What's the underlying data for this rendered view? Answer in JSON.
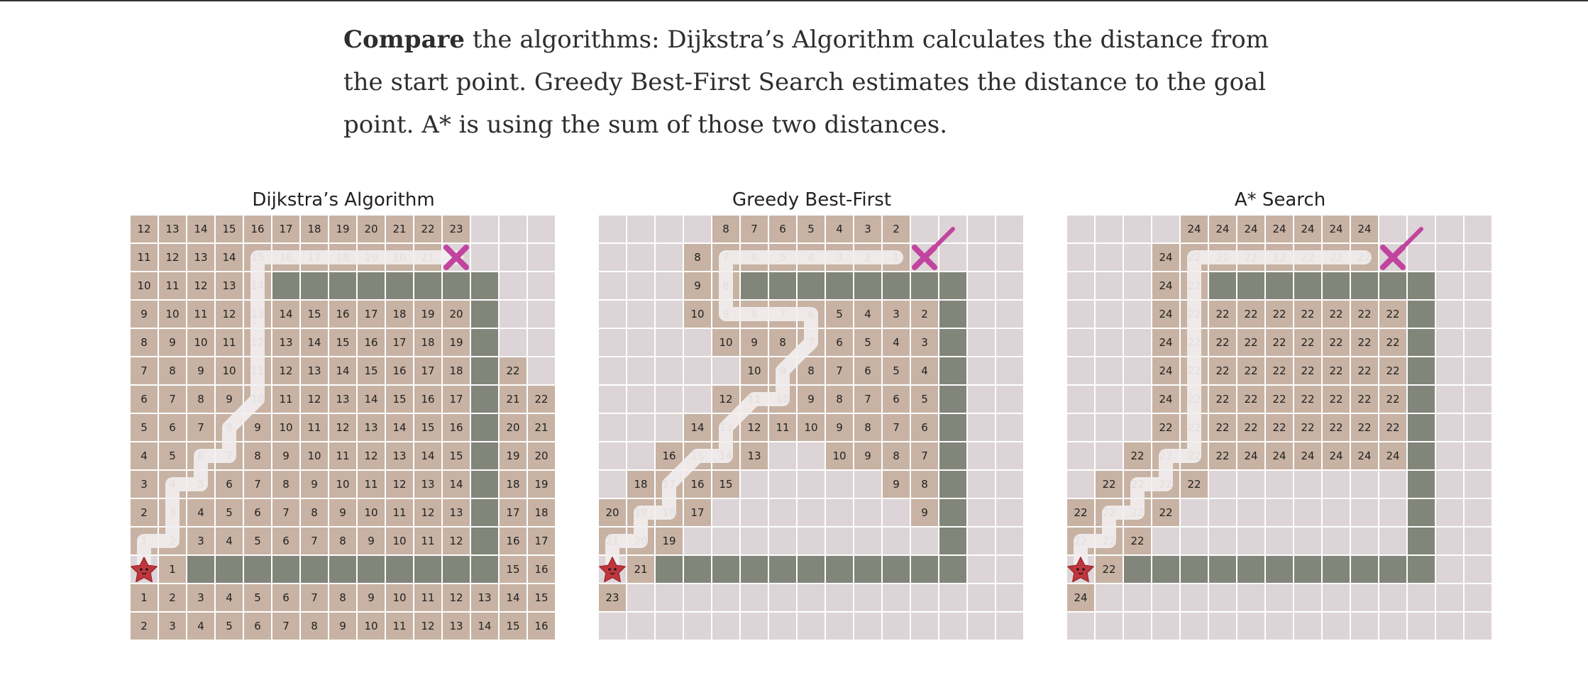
{
  "intro": {
    "bold": "Compare",
    "text": " the algorithms: Dijkstra’s Algorithm calculates the distance from the start point. Greedy Best-First Search estimates the distance to the goal point. A* is using the sum of those two distances."
  },
  "colors": {
    "empty": "#dcd4d6",
    "visited": "#c7b2a3",
    "wall": "#82857a",
    "path": "#f2efef",
    "start": "#c0363d",
    "goal": "#c2449e"
  },
  "icons": {
    "start": "star-icon",
    "goal": "x-mark-icon"
  },
  "panels": [
    {
      "title": "Dijkstra’s Algorithm",
      "grid": [
        [
          "12",
          "13",
          "14",
          "15",
          "16",
          "17",
          "18",
          "19",
          "20",
          "21",
          "22",
          "23",
          "",
          "",
          ""
        ],
        [
          "11",
          "12",
          "13",
          "14",
          "15",
          "16",
          "17",
          "18",
          "19",
          "20",
          "21",
          "G",
          "",
          "",
          ""
        ],
        [
          "10",
          "11",
          "12",
          "13",
          "14",
          "#",
          "#",
          "#",
          "#",
          "#",
          "#",
          "#",
          "#",
          "",
          ""
        ],
        [
          "9",
          "10",
          "11",
          "12",
          "13",
          "14",
          "15",
          "16",
          "17",
          "18",
          "19",
          "20",
          "#",
          "",
          ""
        ],
        [
          "8",
          "9",
          "10",
          "11",
          "12",
          "13",
          "14",
          "15",
          "16",
          "17",
          "18",
          "19",
          "#",
          "",
          ""
        ],
        [
          "7",
          "8",
          "9",
          "10",
          "11",
          "12",
          "13",
          "14",
          "15",
          "16",
          "17",
          "18",
          "#",
          "22",
          ""
        ],
        [
          "6",
          "7",
          "8",
          "9",
          "10",
          "11",
          "12",
          "13",
          "14",
          "15",
          "16",
          "17",
          "#",
          "21",
          "22"
        ],
        [
          "5",
          "6",
          "7",
          "8",
          "9",
          "10",
          "11",
          "12",
          "13",
          "14",
          "15",
          "16",
          "#",
          "20",
          "21"
        ],
        [
          "4",
          "5",
          "6",
          "7",
          "8",
          "9",
          "10",
          "11",
          "12",
          "13",
          "14",
          "15",
          "#",
          "19",
          "20"
        ],
        [
          "3",
          "4",
          "5",
          "6",
          "7",
          "8",
          "9",
          "10",
          "11",
          "12",
          "13",
          "14",
          "#",
          "18",
          "19"
        ],
        [
          "2",
          "3",
          "4",
          "5",
          "6",
          "7",
          "8",
          "9",
          "10",
          "11",
          "12",
          "13",
          "#",
          "17",
          "18"
        ],
        [
          "1",
          "2",
          "3",
          "4",
          "5",
          "6",
          "7",
          "8",
          "9",
          "10",
          "11",
          "12",
          "#",
          "16",
          "17"
        ],
        [
          "S",
          "1",
          "#",
          "#",
          "#",
          "#",
          "#",
          "#",
          "#",
          "#",
          "#",
          "#",
          "#",
          "15",
          "16"
        ],
        [
          "1",
          "2",
          "3",
          "4",
          "5",
          "6",
          "7",
          "8",
          "9",
          "10",
          "11",
          "12",
          "13",
          "14",
          "15"
        ],
        [
          "2",
          "3",
          "4",
          "5",
          "6",
          "7",
          "8",
          "9",
          "10",
          "11",
          "12",
          "13",
          "14",
          "15",
          "16"
        ]
      ],
      "path": [
        [
          12,
          0
        ],
        [
          11,
          0
        ],
        [
          11,
          1
        ],
        [
          10,
          1
        ],
        [
          9,
          1
        ],
        [
          9,
          2
        ],
        [
          8,
          2
        ],
        [
          8,
          3
        ],
        [
          7,
          3
        ],
        [
          6,
          4
        ],
        [
          5,
          4
        ],
        [
          4,
          4
        ],
        [
          3,
          4
        ],
        [
          2,
          4
        ],
        [
          1,
          4
        ],
        [
          1,
          5
        ],
        [
          1,
          6
        ],
        [
          1,
          7
        ],
        [
          1,
          8
        ],
        [
          1,
          9
        ],
        [
          1,
          10
        ],
        [
          1,
          11
        ]
      ],
      "arrow": false
    },
    {
      "title": "Greedy Best-First",
      "grid": [
        [
          "",
          "",
          "",
          "",
          "8",
          "7",
          "6",
          "5",
          "4",
          "3",
          "2",
          "",
          "",
          "",
          ""
        ],
        [
          "",
          "",
          "",
          "8",
          "7",
          "6",
          "5",
          "4",
          "3",
          "2",
          "1",
          "G",
          "",
          "",
          ""
        ],
        [
          "",
          "",
          "",
          "9",
          "8",
          "#",
          "#",
          "#",
          "#",
          "#",
          "#",
          "#",
          "#",
          "",
          ""
        ],
        [
          "",
          "",
          "",
          "10",
          "9",
          "8",
          "7",
          "6",
          "5",
          "4",
          "3",
          "2",
          "#",
          "",
          ""
        ],
        [
          "",
          "",
          "",
          "",
          "10",
          "9",
          "8",
          "7",
          "6",
          "5",
          "4",
          "3",
          "#",
          "",
          ""
        ],
        [
          "",
          "",
          "",
          "",
          "",
          "10",
          "9",
          "8",
          "7",
          "6",
          "5",
          "4",
          "#",
          "",
          ""
        ],
        [
          "",
          "",
          "",
          "",
          "12",
          "11",
          "10",
          "9",
          "8",
          "7",
          "6",
          "5",
          "#",
          "",
          ""
        ],
        [
          "",
          "",
          "",
          "14",
          "13",
          "12",
          "11",
          "10",
          "9",
          "8",
          "7",
          "6",
          "#",
          "",
          ""
        ],
        [
          "",
          "",
          "16",
          "15",
          "14",
          "13",
          "",
          "",
          "10",
          "9",
          "8",
          "7",
          "#",
          "",
          ""
        ],
        [
          "",
          "18",
          "17",
          "16",
          "15",
          "",
          "",
          "",
          "",
          "",
          "9",
          "8",
          "#",
          "",
          ""
        ],
        [
          "20",
          "19",
          "18",
          "17",
          "",
          "",
          "",
          "",
          "",
          "",
          "",
          "9",
          "#",
          "",
          ""
        ],
        [
          "21",
          "20",
          "19",
          "",
          "",
          "",
          "",
          "",
          "",
          "",
          "",
          "",
          "#",
          "",
          ""
        ],
        [
          "S",
          "21",
          "#",
          "#",
          "#",
          "#",
          "#",
          "#",
          "#",
          "#",
          "#",
          "#",
          "#",
          "",
          ""
        ],
        [
          "23",
          "",
          "",
          "",
          "",
          "",
          "",
          "",
          "",
          "",
          "",
          "",
          "",
          "",
          ""
        ],
        [
          "",
          "",
          "",
          "",
          "",
          "",
          "",
          "",
          "",
          "",
          "",
          "",
          "",
          "",
          ""
        ]
      ],
      "path": [
        [
          12,
          0
        ],
        [
          11,
          0
        ],
        [
          11,
          1
        ],
        [
          10,
          1
        ],
        [
          10,
          2
        ],
        [
          9,
          2
        ],
        [
          8,
          3
        ],
        [
          8,
          4
        ],
        [
          7,
          4
        ],
        [
          6,
          5
        ],
        [
          6,
          6
        ],
        [
          5,
          6
        ],
        [
          4,
          7
        ],
        [
          3,
          7
        ],
        [
          3,
          6
        ],
        [
          3,
          5
        ],
        [
          3,
          4
        ],
        [
          2,
          4
        ],
        [
          1,
          4
        ],
        [
          1,
          5
        ],
        [
          1,
          6
        ],
        [
          1,
          7
        ],
        [
          1,
          8
        ],
        [
          1,
          9
        ],
        [
          1,
          10
        ]
      ],
      "arrow": true
    },
    {
      "title": "A* Search",
      "grid": [
        [
          "",
          "",
          "",
          "",
          "24",
          "24",
          "24",
          "24",
          "24",
          "24",
          "24",
          "",
          "",
          "",
          ""
        ],
        [
          "",
          "",
          "",
          "24",
          "22",
          "22",
          "22",
          "22",
          "22",
          "22",
          "22",
          "G",
          "",
          "",
          ""
        ],
        [
          "",
          "",
          "",
          "24",
          "22",
          "#",
          "#",
          "#",
          "#",
          "#",
          "#",
          "#",
          "#",
          "",
          ""
        ],
        [
          "",
          "",
          "",
          "24",
          "22",
          "22",
          "22",
          "22",
          "22",
          "22",
          "22",
          "22",
          "#",
          "",
          ""
        ],
        [
          "",
          "",
          "",
          "24",
          "22",
          "22",
          "22",
          "22",
          "22",
          "22",
          "22",
          "22",
          "#",
          "",
          ""
        ],
        [
          "",
          "",
          "",
          "24",
          "22",
          "22",
          "22",
          "22",
          "22",
          "22",
          "22",
          "22",
          "#",
          "",
          ""
        ],
        [
          "",
          "",
          "",
          "24",
          "22",
          "22",
          "22",
          "22",
          "22",
          "22",
          "22",
          "22",
          "#",
          "",
          ""
        ],
        [
          "",
          "",
          "",
          "22",
          "22",
          "22",
          "22",
          "22",
          "22",
          "22",
          "22",
          "22",
          "#",
          "",
          ""
        ],
        [
          "",
          "",
          "22",
          "22",
          "22",
          "22",
          "24",
          "24",
          "24",
          "24",
          "24",
          "24",
          "#",
          "",
          ""
        ],
        [
          "",
          "22",
          "22",
          "22",
          "22",
          "",
          "",
          "",
          "",
          "",
          "",
          "",
          "#",
          "",
          ""
        ],
        [
          "22",
          "22",
          "22",
          "22",
          "",
          "",
          "",
          "",
          "",
          "",
          "",
          "",
          "#",
          "",
          ""
        ],
        [
          "22",
          "22",
          "22",
          "",
          "",
          "",
          "",
          "",
          "",
          "",
          "",
          "",
          "#",
          "",
          ""
        ],
        [
          "S",
          "22",
          "#",
          "#",
          "#",
          "#",
          "#",
          "#",
          "#",
          "#",
          "#",
          "#",
          "#",
          "",
          ""
        ],
        [
          "24",
          "",
          "",
          "",
          "",
          "",
          "",
          "",
          "",
          "",
          "",
          "",
          "",
          "",
          ""
        ],
        [
          "",
          "",
          "",
          "",
          "",
          "",
          "",
          "",
          "",
          "",
          "",
          "",
          "",
          "",
          ""
        ]
      ],
      "path": [
        [
          12,
          0
        ],
        [
          11,
          0
        ],
        [
          11,
          1
        ],
        [
          10,
          1
        ],
        [
          10,
          2
        ],
        [
          9,
          2
        ],
        [
          9,
          3
        ],
        [
          8,
          3
        ],
        [
          8,
          4
        ],
        [
          7,
          4
        ],
        [
          6,
          4
        ],
        [
          5,
          4
        ],
        [
          4,
          4
        ],
        [
          3,
          4
        ],
        [
          2,
          4
        ],
        [
          1,
          4
        ],
        [
          1,
          5
        ],
        [
          1,
          6
        ],
        [
          1,
          7
        ],
        [
          1,
          8
        ],
        [
          1,
          9
        ],
        [
          1,
          10
        ]
      ],
      "arrow": true
    }
  ]
}
